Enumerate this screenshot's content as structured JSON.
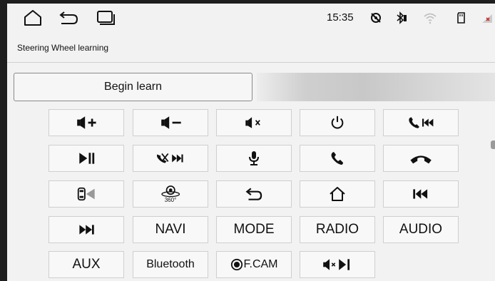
{
  "status_bar": {
    "time": "15:35",
    "nav_icons": [
      "home-icon",
      "back-icon",
      "recent-apps-icon"
    ],
    "status_icons": [
      "no-sim-icon",
      "bluetooth-icon",
      "wifi-icon",
      "sd-card-icon",
      "signal-icon"
    ]
  },
  "page": {
    "title": "Steering Wheel learning"
  },
  "learn": {
    "button_label": "Begin learn",
    "progress": 0.4
  },
  "keys": [
    {
      "id": "volume-up",
      "icon": "volume-up-icon"
    },
    {
      "id": "volume-down",
      "icon": "volume-down-icon"
    },
    {
      "id": "mute",
      "icon": "mute-icon"
    },
    {
      "id": "power",
      "icon": "power-icon"
    },
    {
      "id": "call-prev",
      "icon": "call-previous-icon"
    },
    {
      "id": "play-pause",
      "icon": "play-pause-icon"
    },
    {
      "id": "hangup-next",
      "icon": "hangup-next-icon"
    },
    {
      "id": "voice",
      "icon": "microphone-icon"
    },
    {
      "id": "call",
      "icon": "phone-call-icon"
    },
    {
      "id": "hangup",
      "icon": "phone-hangup-icon"
    },
    {
      "id": "parking-camera",
      "icon": "car-camera-icon"
    },
    {
      "id": "camera-360",
      "icon": "camera-360-icon",
      "text": "360°"
    },
    {
      "id": "back",
      "icon": "back-icon"
    },
    {
      "id": "home",
      "icon": "home-icon"
    },
    {
      "id": "previous",
      "icon": "previous-track-icon"
    },
    {
      "id": "next",
      "icon": "next-track-icon"
    },
    {
      "id": "navi",
      "label": "NAVI"
    },
    {
      "id": "mode",
      "label": "MODE"
    },
    {
      "id": "radio",
      "label": "RADIO"
    },
    {
      "id": "audio",
      "label": "AUDIO"
    },
    {
      "id": "aux",
      "label": "AUX"
    },
    {
      "id": "bluetooth",
      "label": "Bluetooth"
    },
    {
      "id": "front-camera",
      "icon": "front-camera-icon",
      "label": "F.CAM"
    },
    {
      "id": "mute-play-pause",
      "icon": "mute-play-pause-icon"
    }
  ],
  "colors": {
    "background": "#f2f2f2",
    "key_border": "#cfcfcf",
    "text": "#111111"
  }
}
